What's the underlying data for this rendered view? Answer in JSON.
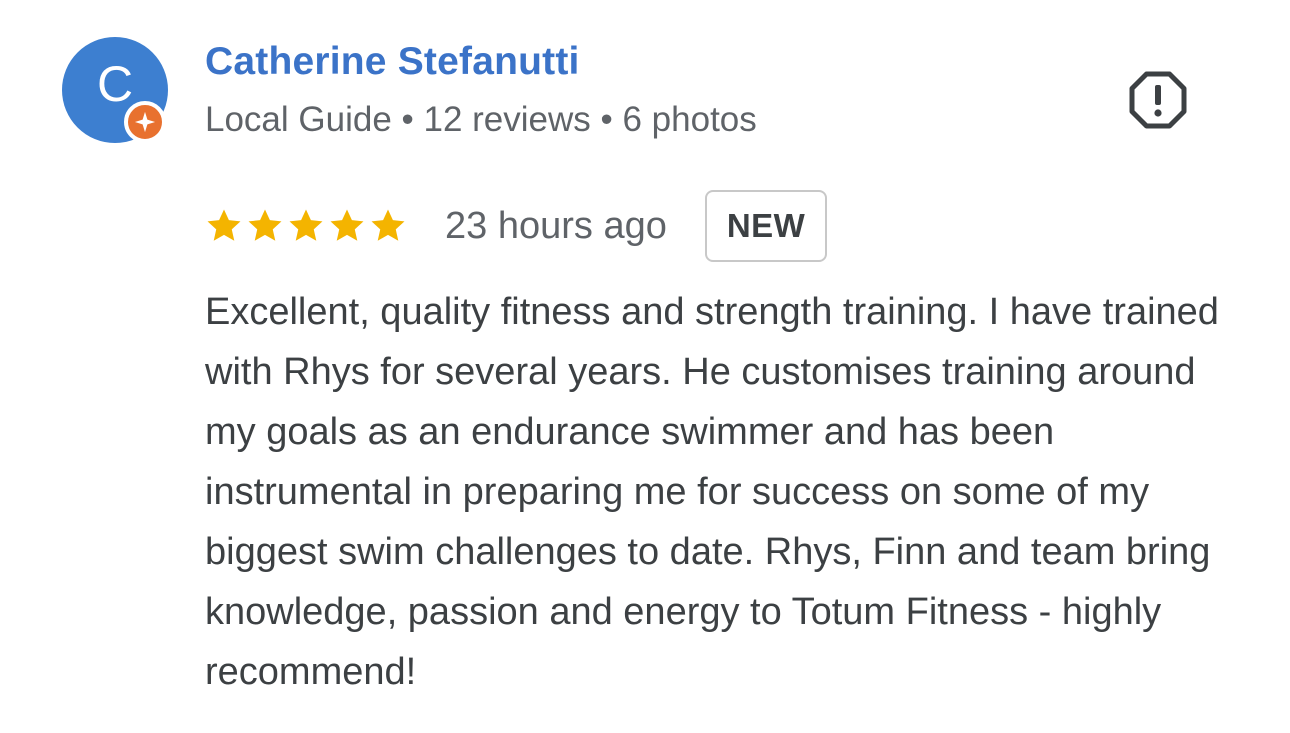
{
  "review": {
    "reviewer": {
      "initial": "C",
      "name": "Catherine Stefanutti",
      "meta": "Local Guide • 12 reviews • 6 photos",
      "avatar_color": "#3d7fd0",
      "badge_color": "#e8712f",
      "badge_icon": "local-guide-star-icon"
    },
    "report_icon": "report-flag-icon",
    "rating": 5,
    "rating_max": 5,
    "star_color": "#f4b400",
    "time": "23 hours ago",
    "badge": "NEW",
    "text": "Excellent, quality fitness and strength training. I have trained with Rhys for several years. He customises training around my goals as an endurance swimmer and has been instrumental in preparing me for success on some of my biggest swim challenges to date. Rhys, Finn and team bring knowledge, passion and energy to Totum Fitness - highly recommend!"
  }
}
